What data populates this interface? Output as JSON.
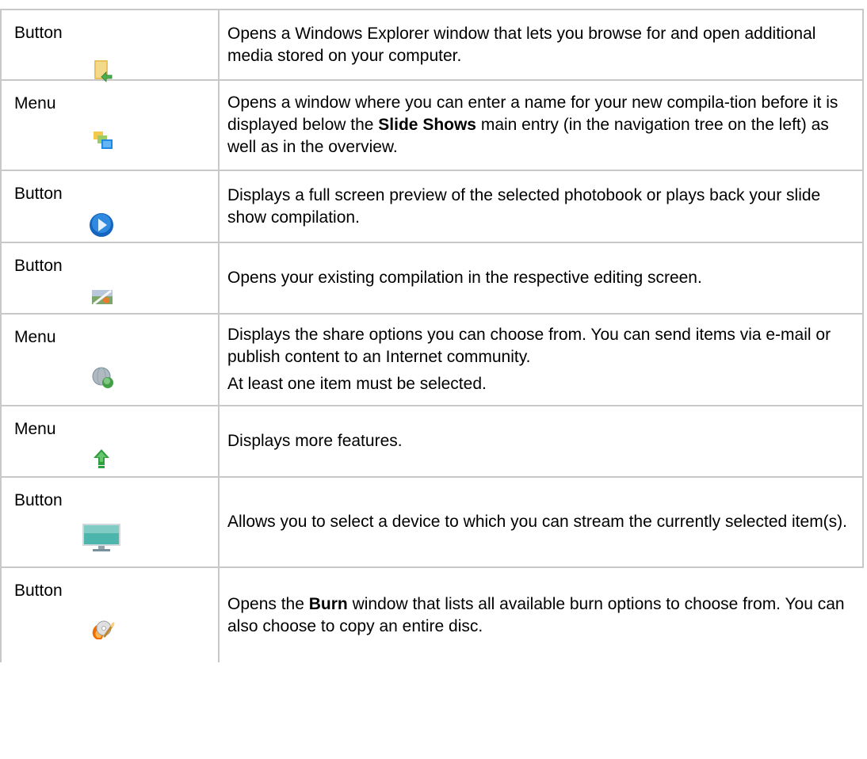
{
  "rows": [
    {
      "type": "Button",
      "icon": "open-folder-icon",
      "parts": [
        {
          "text": "Opens a Windows Explorer window that lets you browse for and open additional media stored on your computer."
        }
      ]
    },
    {
      "type": "Menu",
      "icon": "new-compilation-icon",
      "parts": [
        {
          "pre": "Opens a window where you can enter a name for your new compila-tion before it is displayed below the ",
          "bold": "Slide Shows",
          "post": " main entry (in the navigation tree on the left) as well as in the overview."
        }
      ]
    },
    {
      "type": "Button",
      "icon": "play-icon",
      "parts": [
        {
          "text": "Displays a full screen preview of the selected photobook or plays back your slide show compilation."
        }
      ]
    },
    {
      "type": "Button",
      "icon": "edit-photo-icon",
      "parts": [
        {
          "text": "Opens your existing compilation in the respective editing screen."
        }
      ]
    },
    {
      "type": "Menu",
      "icon": "share-globe-icon",
      "parts": [
        {
          "text": "Displays the share options you can choose from. You can send items via e-mail or publish content to an Internet community."
        },
        {
          "text": "At least one item must be selected."
        }
      ]
    },
    {
      "type": "Menu",
      "icon": "up-arrow-icon",
      "parts": [
        {
          "text": "Displays more features."
        }
      ]
    },
    {
      "type": "Button",
      "icon": "monitor-icon",
      "parts": [
        {
          "text": "Allows you to select a device to which you can stream the currently selected item(s)."
        }
      ]
    },
    {
      "type": "Button",
      "icon": "burn-disc-icon",
      "parts": [
        {
          "pre": "Opens the ",
          "bold": "Burn",
          "post": " window that lists all available burn options to choose from. You can also choose to copy an entire disc."
        }
      ]
    }
  ]
}
